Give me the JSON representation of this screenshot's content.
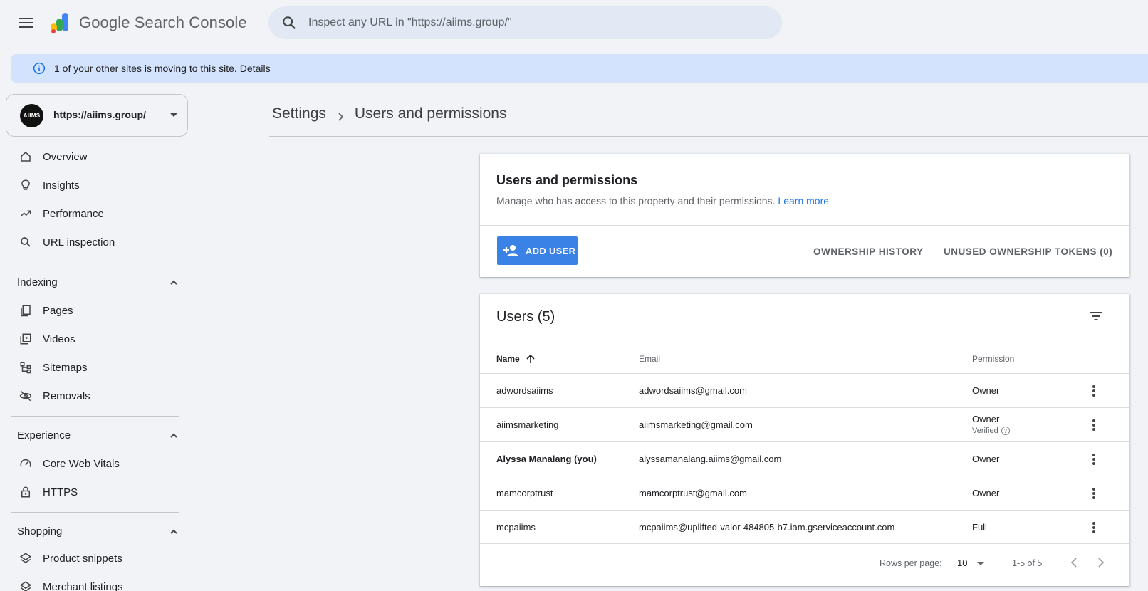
{
  "app": {
    "title_google": "Google",
    "title_product": "Search Console",
    "menu_icon": "hamburger-menu-icon",
    "logo_icon": "search-console-logo"
  },
  "search": {
    "placeholder": "Inspect any URL in \"https://aiims.group/\"",
    "icon": "search-icon"
  },
  "banner": {
    "text": "1 of your other sites is moving to this site.",
    "link": "Details",
    "icon": "info-icon"
  },
  "property": {
    "avatar_text": "AIIMS",
    "url": "https://aiims.group/"
  },
  "sidebar": {
    "items": [
      {
        "label": "Overview",
        "icon": "home-icon"
      },
      {
        "label": "Insights",
        "icon": "lightbulb-icon"
      },
      {
        "label": "Performance",
        "icon": "trending-up-icon"
      },
      {
        "label": "URL inspection",
        "icon": "search-icon"
      }
    ],
    "sections": [
      {
        "label": "Indexing",
        "items": [
          {
            "label": "Pages",
            "icon": "pages-icon"
          },
          {
            "label": "Videos",
            "icon": "video-library-icon"
          },
          {
            "label": "Sitemaps",
            "icon": "sitemap-icon"
          },
          {
            "label": "Removals",
            "icon": "visibility-off-icon"
          }
        ]
      },
      {
        "label": "Experience",
        "items": [
          {
            "label": "Core Web Vitals",
            "icon": "speed-icon"
          },
          {
            "label": "HTTPS",
            "icon": "lock-icon"
          }
        ]
      },
      {
        "label": "Shopping",
        "items": [
          {
            "label": "Product snippets",
            "icon": "layers-icon"
          },
          {
            "label": "Merchant listings",
            "icon": "layers-icon"
          }
        ]
      }
    ]
  },
  "breadcrumb": {
    "parent": "Settings",
    "current": "Users and permissions"
  },
  "permissions_card": {
    "title": "Users and permissions",
    "description": "Manage who has access to this property and their permissions.",
    "learn_more": "Learn more",
    "add_user": "ADD USER",
    "ownership_history": "OWNERSHIP HISTORY",
    "unused_tokens": "UNUSED OWNERSHIP TOKENS (0)"
  },
  "users_card": {
    "title": "Users (5)",
    "columns": {
      "name": "Name",
      "email": "Email",
      "permission": "Permission"
    },
    "rows": [
      {
        "name": "adwordsaiims",
        "email": "adwordsaiims@gmail.com",
        "permission": "Owner"
      },
      {
        "name": "aiimsmarketing",
        "email": "aiimsmarketing@gmail.com",
        "permission": "Owner",
        "sub": "Verified"
      },
      {
        "name": "Alyssa Manalang (you)",
        "email": "alyssamanalang.aiims@gmail.com",
        "permission": "Owner"
      },
      {
        "name": "mamcorptrust",
        "email": "mamcorptrust@gmail.com",
        "permission": "Owner"
      },
      {
        "name": "mcpaiims",
        "email": "mcpaiims@uplifted-valor-484805-b7.iam.gserviceaccount.com",
        "permission": "Full"
      }
    ],
    "pager": {
      "rows_per_page_label": "Rows per page:",
      "rows_per_page": "10",
      "range": "1-5 of 5"
    }
  }
}
